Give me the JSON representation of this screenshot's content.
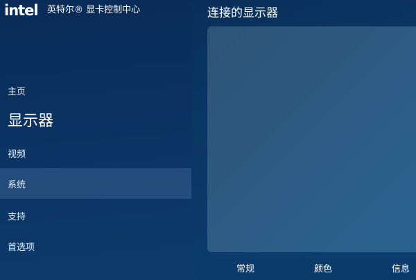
{
  "brand": {
    "logo_text": "intel",
    "app_title": "英特尔® 显卡控制中心"
  },
  "sidebar": {
    "items": [
      {
        "label": "主页"
      },
      {
        "label": "显示器"
      },
      {
        "label": "视频"
      },
      {
        "label": "系统",
        "selected": true
      },
      {
        "label": "支持"
      },
      {
        "label": "首选项"
      }
    ]
  },
  "main": {
    "title": "连接的显示器",
    "tabs": [
      {
        "label": "常规"
      },
      {
        "label": "颜色"
      },
      {
        "label": "信息"
      }
    ]
  },
  "colors": {
    "background": "#0a3663",
    "selected_nav": "#2a5378",
    "panel": "#2c5c85"
  }
}
